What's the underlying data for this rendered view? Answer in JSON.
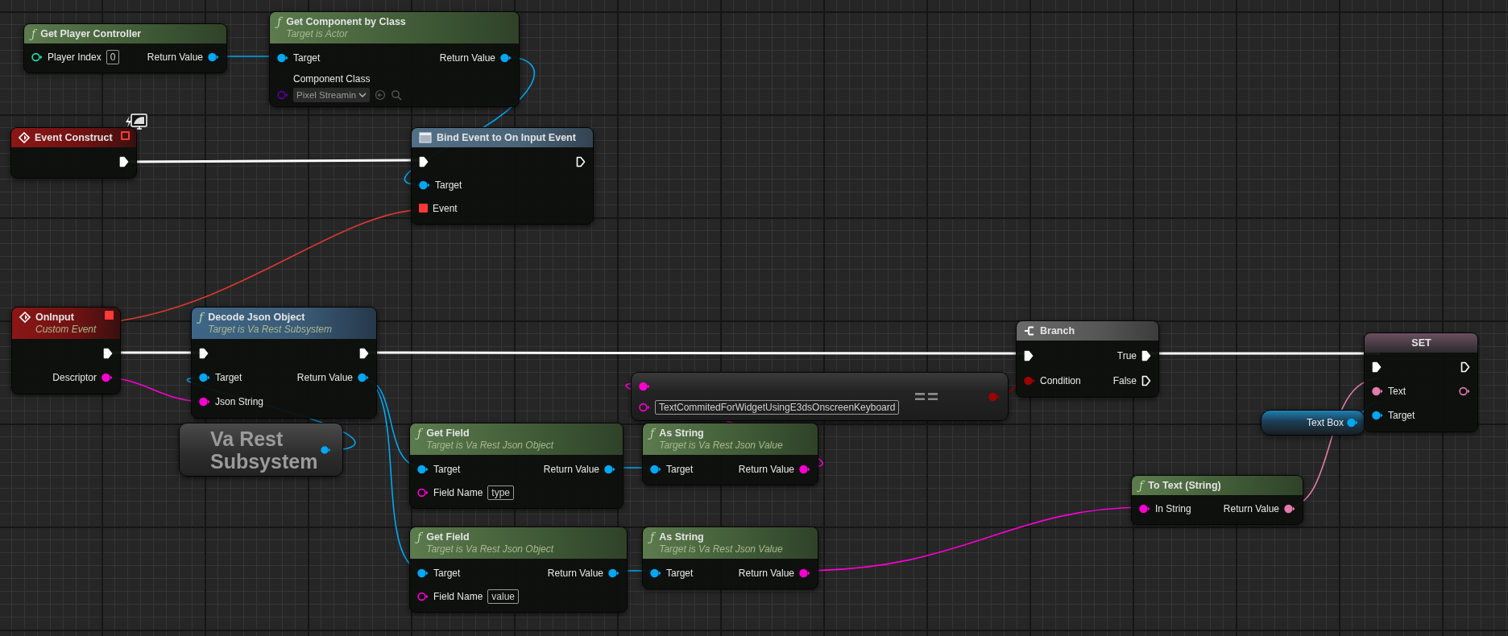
{
  "nodes": [
    {
      "kind": "pure",
      "icon": "ƒ",
      "title": "Get Player Controller",
      "rows": [
        {
          "left": {
            "kind": "int",
            "label": "Player Index",
            "connected": false,
            "value": "0"
          },
          "right": {
            "kind": "object",
            "label": "Return Value",
            "connected": true
          }
        }
      ]
    },
    {
      "kind": "pure",
      "icon": "ƒ",
      "title": "Get Component by Class",
      "subtitle": "Target is Actor",
      "rows": [
        {
          "left": {
            "kind": "object",
            "label": "Target",
            "connected": true
          },
          "right": {
            "kind": "object",
            "label": "Return Value",
            "connected": true
          }
        },
        {
          "left": {
            "kind": "class",
            "label": "Component Class",
            "connected": false,
            "dropdown": "Pixel Streamin"
          }
        }
      ]
    },
    {
      "kind": "event",
      "title": "Event Construct",
      "header_pin": {
        "kind": "delegate",
        "connected": false
      },
      "badge": true,
      "rows": [
        {
          "right": {
            "kind": "exec",
            "connected": true
          }
        }
      ]
    },
    {
      "kind": "bind",
      "title": "Bind Event to On Input Event",
      "rows": [
        {
          "left": {
            "kind": "exec",
            "connected": true
          },
          "right": {
            "kind": "exec",
            "connected": false
          }
        },
        {
          "left": {
            "kind": "object",
            "label": "Target",
            "connected": true
          }
        },
        {
          "left": {
            "kind": "delegate",
            "label": "Event",
            "connected": true
          }
        }
      ]
    },
    {
      "kind": "event",
      "title": "OnInput",
      "subtitle": "Custom Event",
      "header_pin": {
        "kind": "delegate",
        "connected": true
      },
      "badge": false,
      "rows": [
        {
          "right": {
            "kind": "exec",
            "connected": true
          }
        },
        {
          "right": {
            "kind": "string",
            "label": "Descriptor",
            "connected": true
          }
        }
      ]
    },
    {
      "kind": "function",
      "icon": "ƒ",
      "title": "Decode Json Object",
      "subtitle": "Target is Va Rest Subsystem",
      "rows": [
        {
          "left": {
            "kind": "exec",
            "connected": true
          },
          "right": {
            "kind": "exec",
            "connected": true
          }
        },
        {
          "left": {
            "kind": "object",
            "label": "Target",
            "connected": true
          },
          "right": {
            "kind": "object",
            "label": "Return Value",
            "connected": true
          }
        },
        {
          "left": {
            "kind": "string",
            "label": "Json String",
            "connected": true
          }
        }
      ]
    },
    {
      "kind": "subsystem",
      "title": "Va Rest Subsystem",
      "pin": {
        "kind": "object",
        "connected": true
      }
    },
    {
      "kind": "compare",
      "title": "==",
      "rows": [
        {
          "left": {
            "kind": "string",
            "connected": true
          }
        },
        {
          "left": {
            "kind": "string",
            "connected": false,
            "value": "TextCommitedForWidgetUsingE3dsOnscreenKeyboard"
          }
        }
      ],
      "pin": {
        "kind": "bool",
        "connected": true
      }
    },
    {
      "kind": "pure",
      "icon": "ƒ",
      "title": "Get Field",
      "subtitle": "Target is Va Rest Json Object",
      "rows": [
        {
          "left": {
            "kind": "object",
            "label": "Target",
            "connected": true
          },
          "right": {
            "kind": "object",
            "label": "Return Value",
            "connected": true
          }
        },
        {
          "left": {
            "kind": "string",
            "label": "Field Name",
            "connected": false,
            "value": "type"
          }
        }
      ]
    },
    {
      "kind": "pure",
      "icon": "ƒ",
      "title": "As String",
      "subtitle": "Target is Va Rest Json Value",
      "rows": [
        {
          "left": {
            "kind": "object",
            "label": "Target",
            "connected": true
          },
          "right": {
            "kind": "string",
            "label": "Return Value",
            "connected": true
          }
        }
      ]
    },
    {
      "kind": "pure",
      "icon": "ƒ",
      "title": "Get Field",
      "subtitle": "Target is Va Rest Json Object",
      "rows": [
        {
          "left": {
            "kind": "object",
            "label": "Target",
            "connected": true
          },
          "right": {
            "kind": "object",
            "label": "Return Value",
            "connected": true
          }
        },
        {
          "left": {
            "kind": "string",
            "label": "Field Name",
            "connected": false,
            "value": "value"
          }
        }
      ]
    },
    {
      "kind": "pure",
      "icon": "ƒ",
      "title": "As String",
      "subtitle": "Target is Va Rest Json Value",
      "rows": [
        {
          "left": {
            "kind": "object",
            "label": "Target",
            "connected": true
          },
          "right": {
            "kind": "string",
            "label": "Return Value",
            "connected": true
          }
        }
      ]
    },
    {
      "kind": "branch",
      "title": "Branch",
      "rows": [
        {
          "left": {
            "kind": "exec",
            "connected": true
          },
          "right": {
            "kind": "exec",
            "label": "True",
            "connected": true
          }
        },
        {
          "left": {
            "kind": "bool",
            "label": "Condition",
            "connected": true
          },
          "right": {
            "kind": "exec",
            "label": "False",
            "connected": false
          }
        }
      ]
    },
    {
      "kind": "variable",
      "title": "Text Box",
      "pin": {
        "kind": "object",
        "connected": true
      }
    },
    {
      "kind": "set",
      "title": "SET",
      "rows": [
        {
          "left": {
            "kind": "exec",
            "connected": true
          },
          "right": {
            "kind": "exec",
            "connected": false
          }
        },
        {
          "left": {
            "kind": "text",
            "label": "Text",
            "connected": true
          },
          "right": {
            "kind": "text",
            "connected": false
          }
        },
        {
          "left": {
            "kind": "object",
            "label": "Target",
            "connected": true
          }
        }
      ]
    },
    {
      "kind": "pure",
      "icon": "ƒ",
      "title": "To Text (String)",
      "rows": [
        {
          "left": {
            "kind": "string",
            "label": "In String",
            "connected": true
          },
          "right": {
            "kind": "text",
            "label": "Return Value",
            "connected": true
          }
        }
      ]
    }
  ]
}
